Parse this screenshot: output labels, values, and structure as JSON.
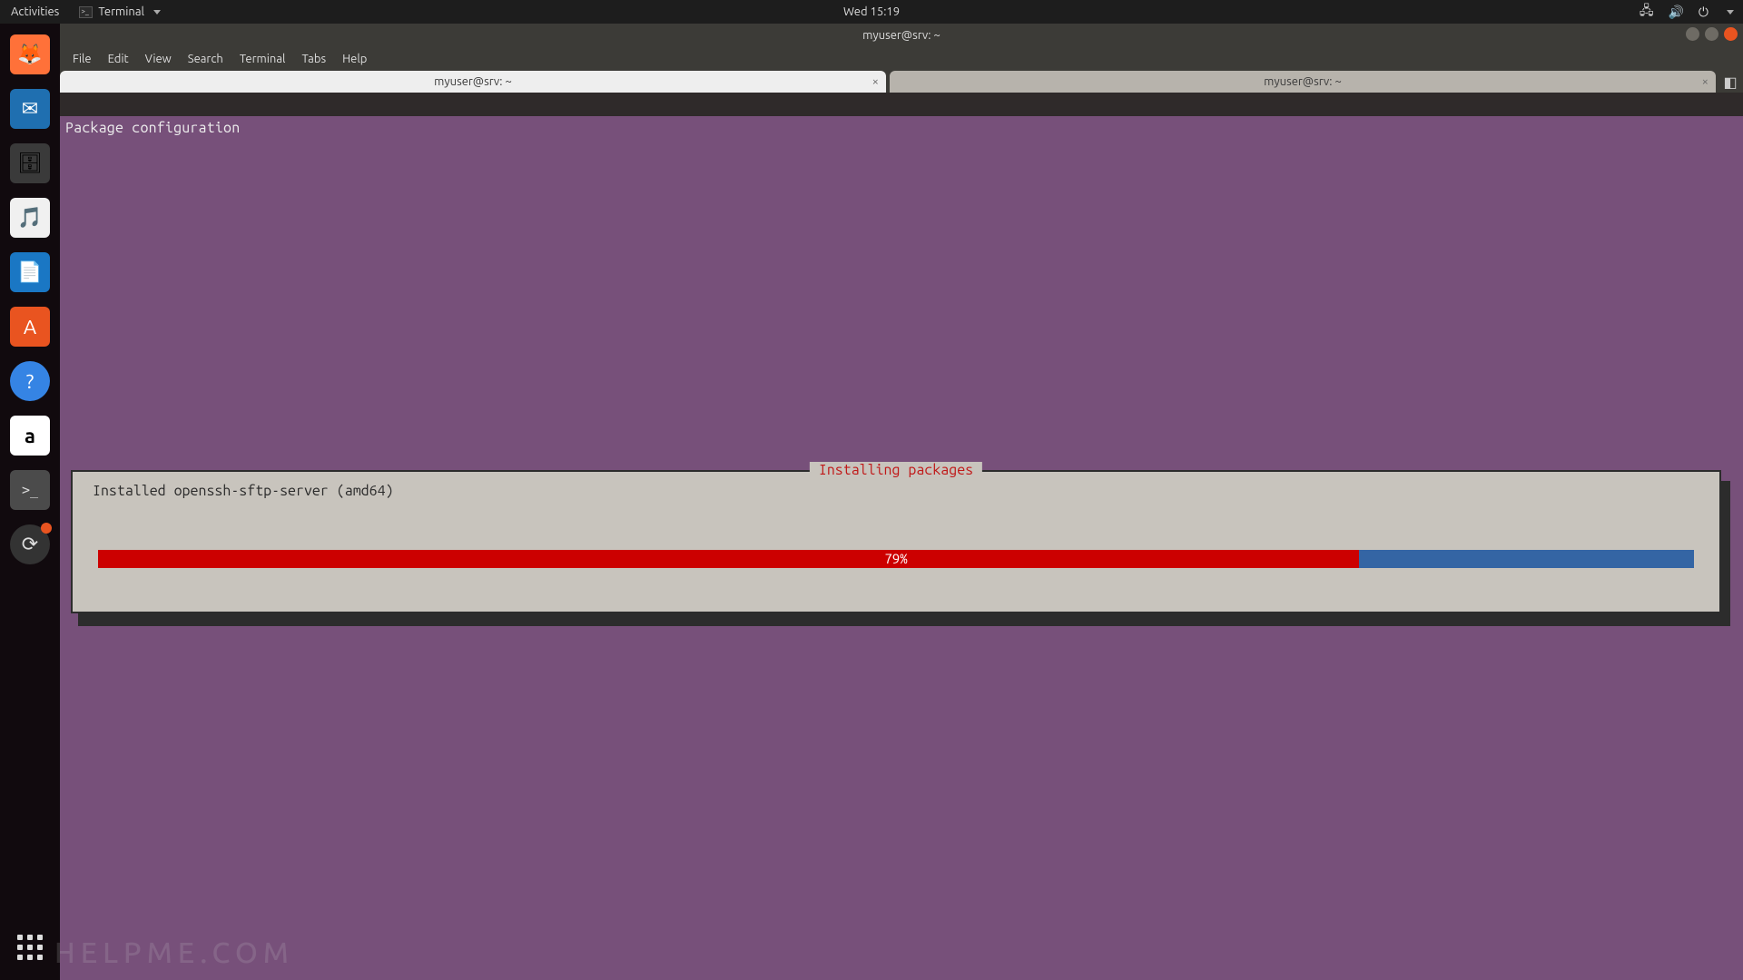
{
  "topbar": {
    "activities": "Activities",
    "app_label": "Terminal",
    "clock": "Wed 15:19"
  },
  "launcher": {
    "items": [
      {
        "name": "firefox",
        "color": "#ff7139",
        "glyph": "🦊"
      },
      {
        "name": "thunderbird",
        "color": "#1f6fb0",
        "glyph": "✉"
      },
      {
        "name": "files",
        "color": "#b58863",
        "glyph": "📁"
      },
      {
        "name": "rhythmbox",
        "color": "#f0f0f0",
        "glyph": "🎵"
      },
      {
        "name": "writer",
        "color": "#1a77c4",
        "glyph": "📄"
      },
      {
        "name": "software",
        "color": "#e95420",
        "glyph": "🛍"
      },
      {
        "name": "help",
        "color": "#3584e4",
        "glyph": "?"
      },
      {
        "name": "amazon",
        "color": "#fff",
        "glyph": "a"
      },
      {
        "name": "terminal",
        "color": "#2b2b2b",
        "glyph": ">_",
        "active": true
      },
      {
        "name": "updater",
        "color": "#333",
        "glyph": "🔄",
        "badge": true
      }
    ]
  },
  "window": {
    "title": "myuser@srv: ~",
    "menu": [
      "File",
      "Edit",
      "View",
      "Search",
      "Terminal",
      "Tabs",
      "Help"
    ],
    "tabs": [
      {
        "label": "myuser@srv: ~",
        "active": true
      },
      {
        "label": "myuser@srv: ~",
        "active": false
      }
    ]
  },
  "terminal": {
    "headline": "Package configuration",
    "dialog": {
      "title": "Installing packages",
      "message": "Installed openssh-sftp-server (amd64)",
      "percent": 79,
      "percent_label": "79%"
    }
  },
  "watermark": "HELPME.COM"
}
